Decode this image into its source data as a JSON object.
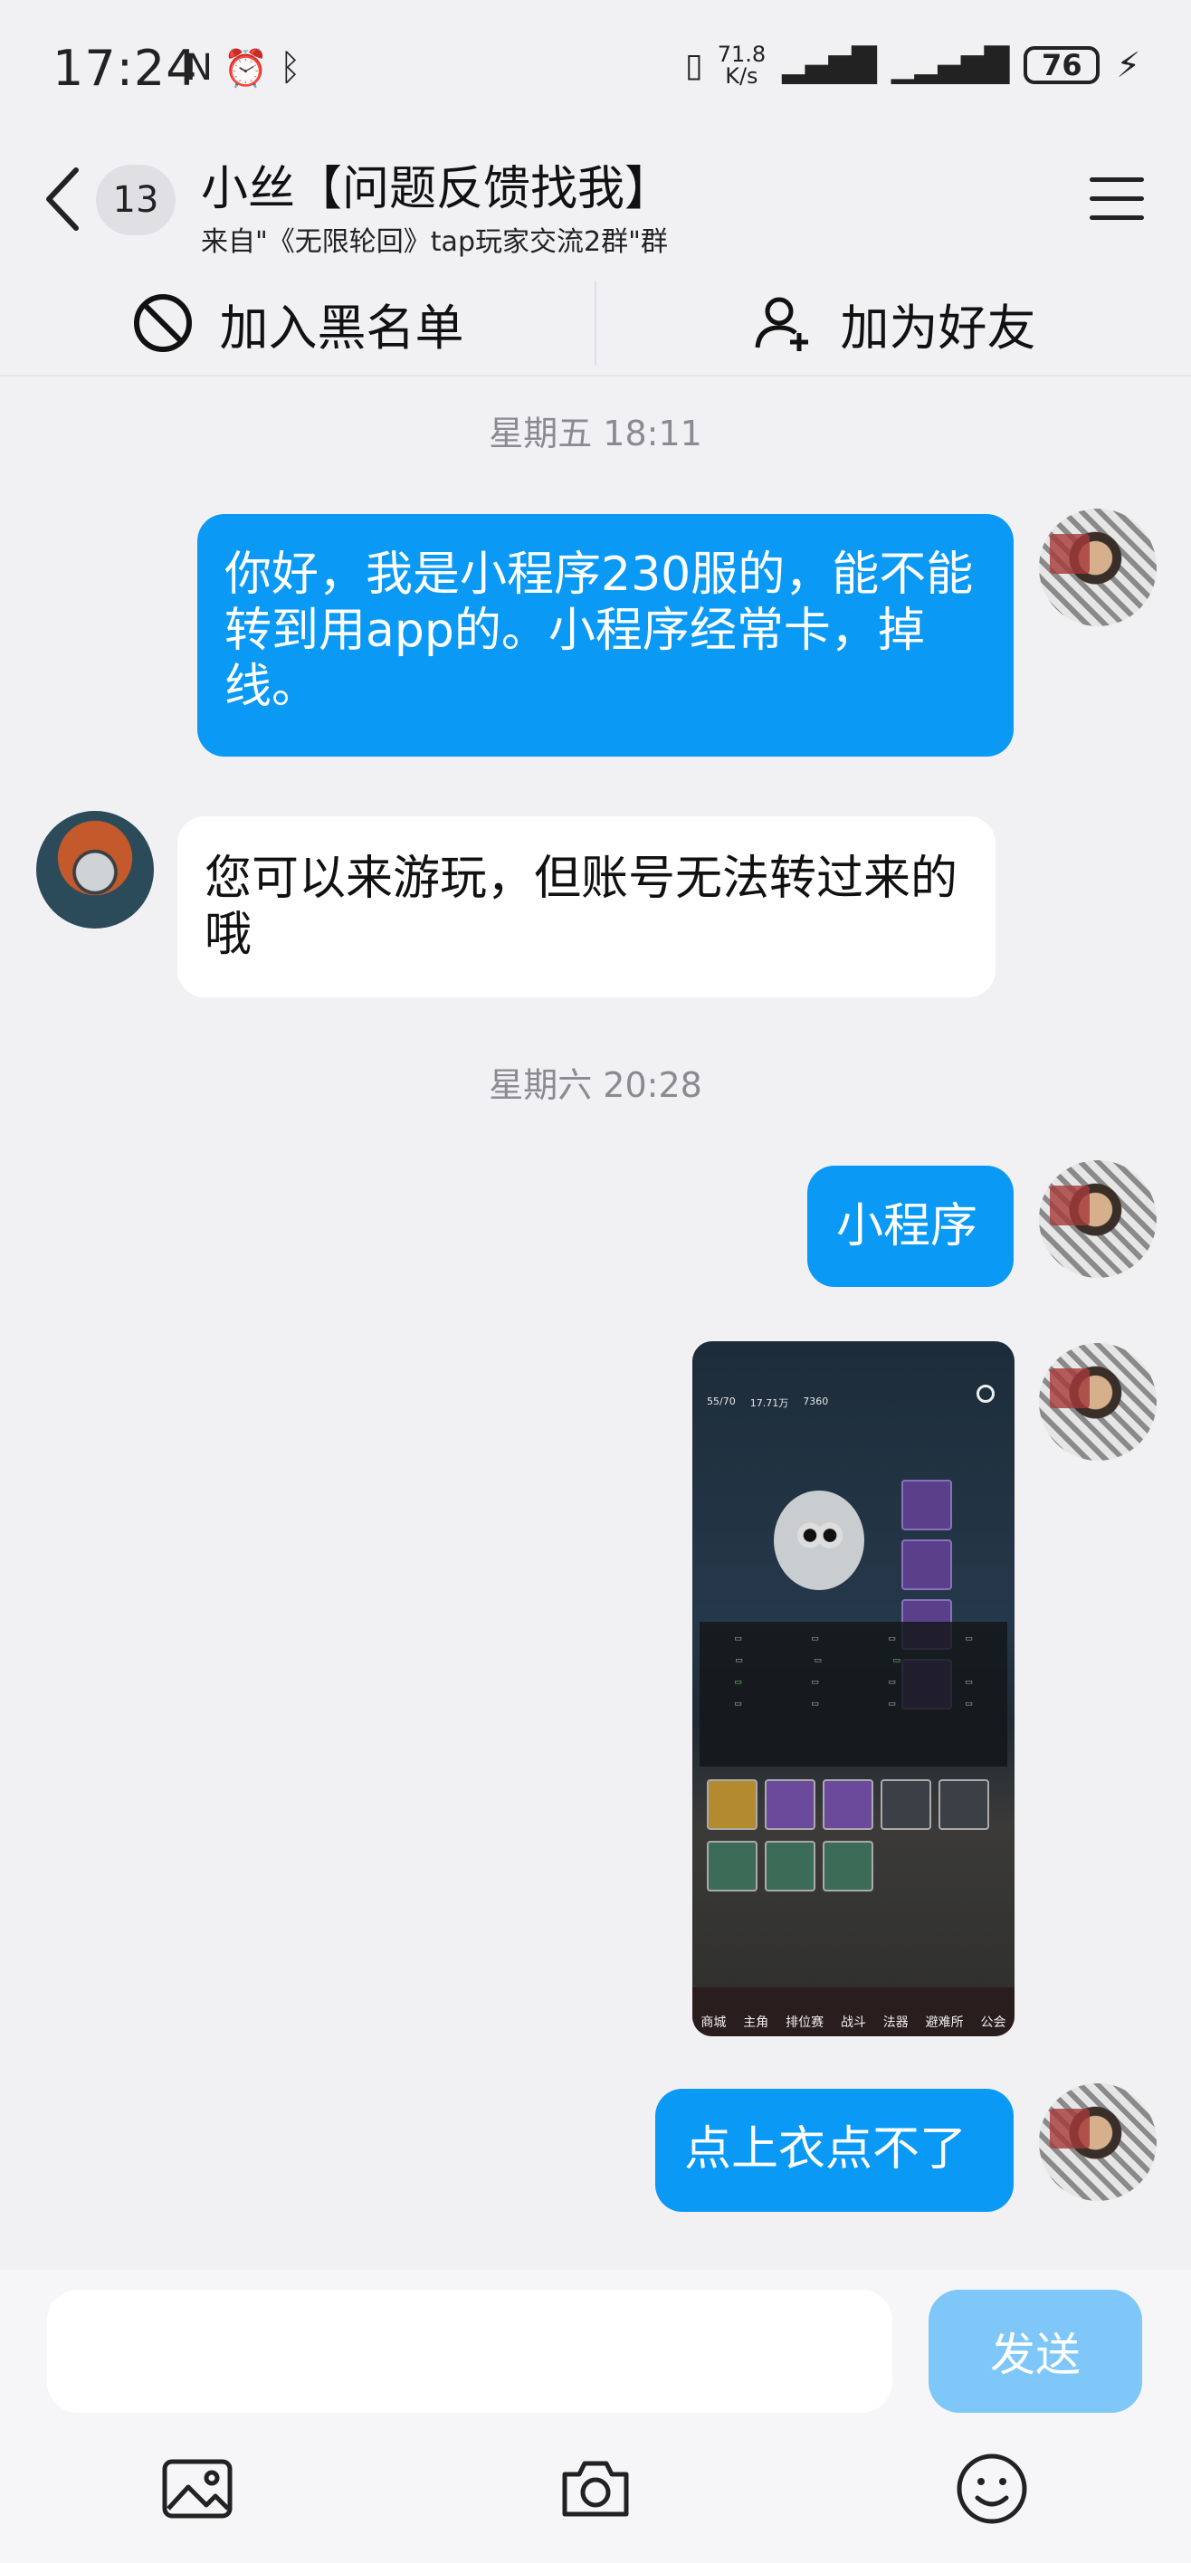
{
  "status_bar": {
    "time": "17:24",
    "left_icons": [
      "nfc-icon",
      "alarm-icon",
      "bluetooth-icon"
    ],
    "net_speed_value": "71.8",
    "net_speed_unit": "K/s",
    "battery": "76"
  },
  "header": {
    "unread_count": "13",
    "title": "小丝【问题反馈找我】",
    "subtitle": "来自\"《无限轮回》tap玩家交流2群\"群"
  },
  "actions": {
    "blacklist": "加入黑名单",
    "add_friend": "加为好友"
  },
  "messages": {
    "time1": "星期五 18:11",
    "msg1": "你好，我是小程序230服的，能不能转到用app的。小程序经常卡，掉线。",
    "msg2": "您可以来游玩，但账号无法转过来的哦",
    "time2": "星期六 20:28",
    "msg3": "小程序",
    "msg5": "点上衣点不了"
  },
  "screenshot": {
    "energy": "55/70",
    "gold": "17.71万",
    "gems": "7360",
    "nav": [
      "商城",
      "主角",
      "排位赛",
      "战斗",
      "法器",
      "避难所",
      "公会"
    ]
  },
  "input": {
    "send_label": "发送"
  },
  "colors": {
    "bubble_blue": "#0a99f5",
    "send_disabled": "#7fc7f8",
    "background": "#f1f1f4"
  }
}
